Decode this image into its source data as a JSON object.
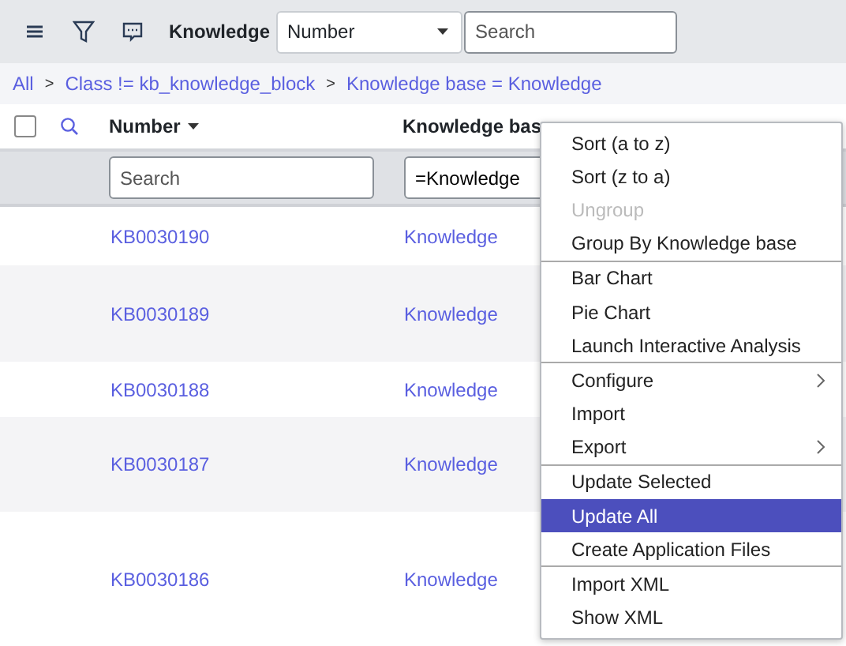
{
  "toolbar": {
    "title": "Knowledge",
    "field_select": "Number",
    "search": {
      "placeholder": "Search"
    }
  },
  "breadcrumbs": {
    "separator": ">",
    "items": [
      "All",
      "Class != kb_knowledge_block",
      "Knowledge base = Knowledge"
    ]
  },
  "table": {
    "select_all": {
      "checked": false
    },
    "columns": [
      {
        "label": "Number",
        "sorted": true
      },
      {
        "label": "Knowledge bas",
        "sorted": false
      }
    ],
    "filters": [
      {
        "placeholder": "Search"
      },
      {
        "value": "=Knowledge"
      }
    ],
    "rows": [
      {
        "number": "KB0030190",
        "knowledge_base": "Knowledge"
      },
      {
        "number": "KB0030189",
        "knowledge_base": "Knowledge"
      },
      {
        "number": "KB0030188",
        "knowledge_base": "Knowledge"
      },
      {
        "number": "KB0030187",
        "knowledge_base": "Knowledge"
      },
      {
        "number": "KB0030186",
        "knowledge_base": "Knowledge"
      }
    ]
  },
  "context_menu": {
    "items": [
      {
        "label": "Sort (a to z)",
        "disabled": false,
        "selected": false,
        "submenu": false,
        "separator_after": false
      },
      {
        "label": "Sort (z to a)",
        "disabled": false,
        "selected": false,
        "submenu": false,
        "separator_after": false
      },
      {
        "label": "Ungroup",
        "disabled": true,
        "selected": false,
        "submenu": false,
        "separator_after": false
      },
      {
        "label": "Group By Knowledge base",
        "disabled": false,
        "selected": false,
        "submenu": false,
        "separator_after": true
      },
      {
        "label": "Bar Chart",
        "disabled": false,
        "selected": false,
        "submenu": false,
        "separator_after": false
      },
      {
        "label": "Pie Chart",
        "disabled": false,
        "selected": false,
        "submenu": false,
        "separator_after": false
      },
      {
        "label": "Launch Interactive Analysis",
        "disabled": false,
        "selected": false,
        "submenu": false,
        "separator_after": true
      },
      {
        "label": "Configure",
        "disabled": false,
        "selected": false,
        "submenu": true,
        "separator_after": false
      },
      {
        "label": "Import",
        "disabled": false,
        "selected": false,
        "submenu": false,
        "separator_after": false
      },
      {
        "label": "Export",
        "disabled": false,
        "selected": false,
        "submenu": true,
        "separator_after": true
      },
      {
        "label": "Update Selected",
        "disabled": false,
        "selected": false,
        "submenu": false,
        "separator_after": false
      },
      {
        "label": "Update All",
        "disabled": false,
        "selected": true,
        "submenu": false,
        "separator_after": false
      },
      {
        "label": "Create Application Files",
        "disabled": false,
        "selected": false,
        "submenu": false,
        "separator_after": true
      },
      {
        "label": "Import XML",
        "disabled": false,
        "selected": false,
        "submenu": false,
        "separator_after": false
      },
      {
        "label": "Show XML",
        "disabled": false,
        "selected": false,
        "submenu": false,
        "separator_after": false
      }
    ]
  }
}
